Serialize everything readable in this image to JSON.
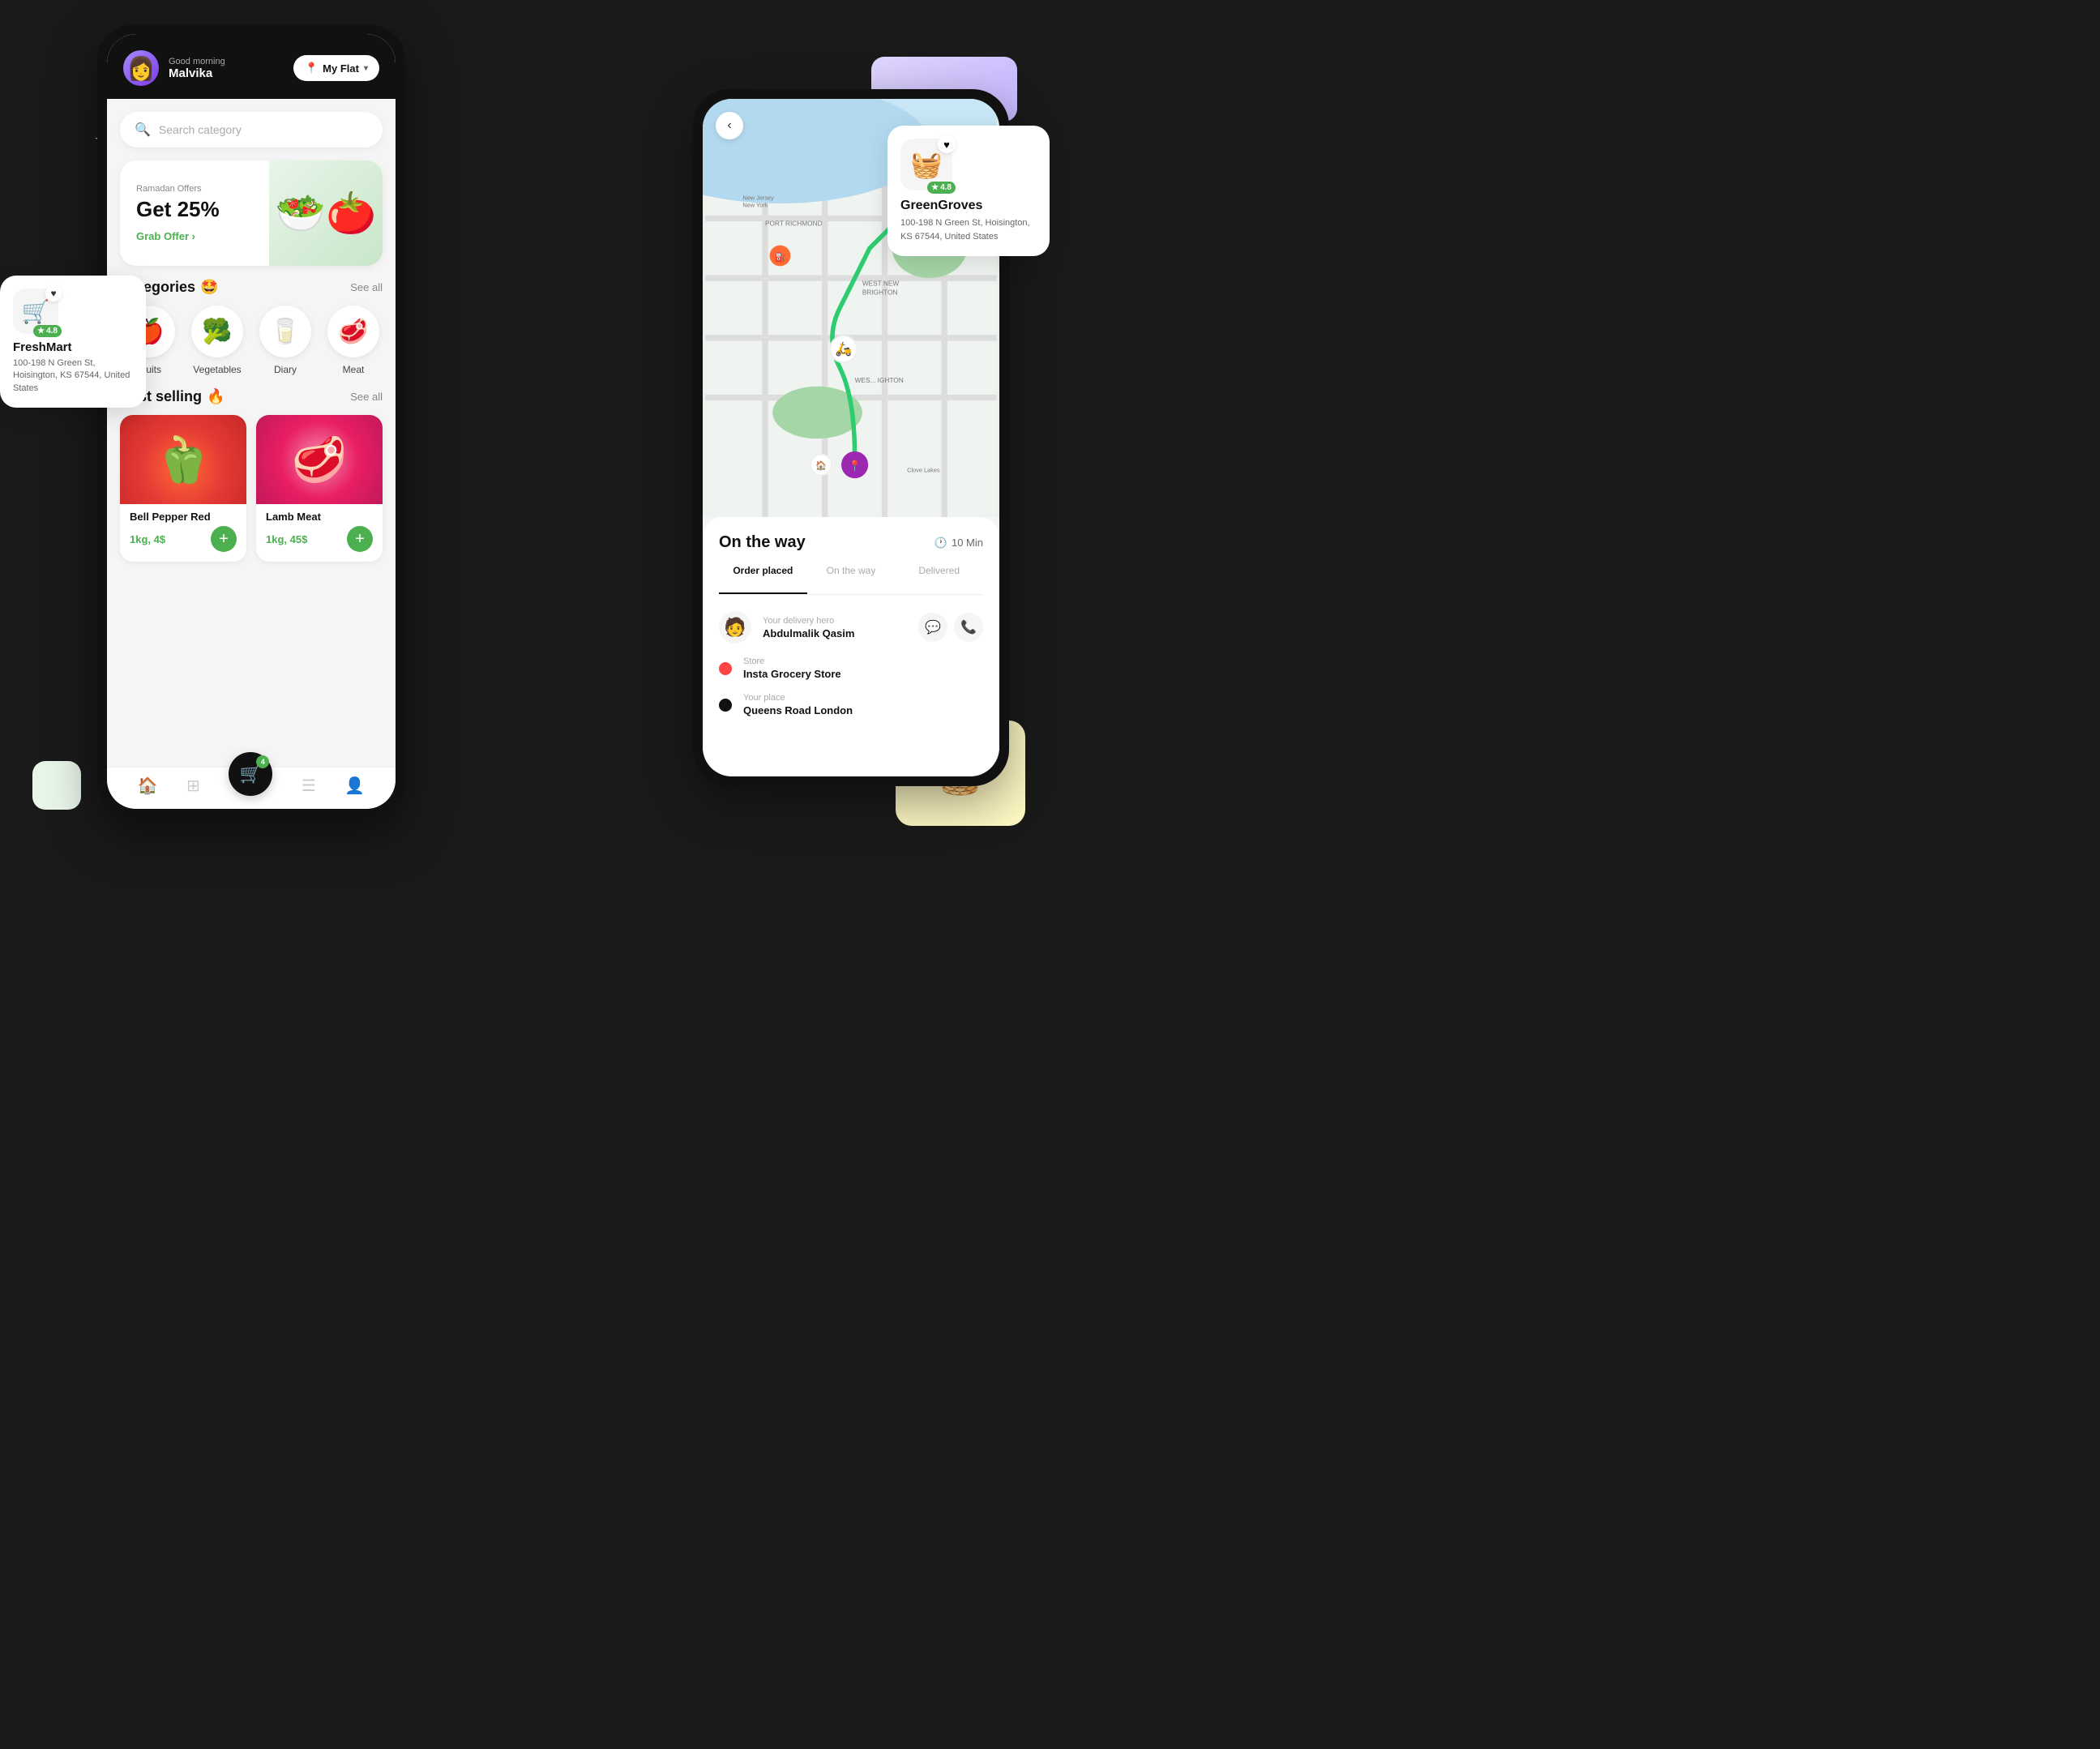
{
  "header": {
    "greeting": "Good morning",
    "user_name": "Malvika",
    "location": "My Flat",
    "location_icon": "📍"
  },
  "search": {
    "placeholder": "Search category"
  },
  "banner": {
    "tag": "Ramadan Offers",
    "title": "Get 25%",
    "button_label": "Grab Offer ›",
    "emoji": "🥗"
  },
  "categories": {
    "title": "Categories",
    "emoji": "🤩",
    "see_all": "See all",
    "items": [
      {
        "label": "Fruits",
        "emoji": "🍎"
      },
      {
        "label": "Vegetables",
        "emoji": "🥦"
      },
      {
        "label": "Diary",
        "emoji": "🥛"
      },
      {
        "label": "Meat",
        "emoji": "🥩"
      }
    ]
  },
  "best_selling": {
    "title": "Best selling",
    "emoji": "🔥",
    "see_all": "See all",
    "products": [
      {
        "name": "Bell Pepper Red",
        "price": "1kg, 4$",
        "emoji": "🫑"
      },
      {
        "name": "Lamb Meat",
        "price": "1kg, 45$",
        "emoji": "🥩"
      }
    ]
  },
  "bottom_nav": {
    "items": [
      "🏠",
      "⊞",
      "🛒",
      "☰",
      "👤"
    ],
    "cart_count": "4"
  },
  "delivery": {
    "title": "On the way",
    "time": "10 Min",
    "steps": [
      "Order placed",
      "On the way",
      "Delivered"
    ],
    "active_step": 0,
    "hero": {
      "label": "Your delivery hero",
      "name": "Abdulmalik Qasim",
      "emoji": "🧑"
    },
    "store": {
      "label": "Store",
      "name": "Insta Grocery Store"
    },
    "destination": {
      "label": "Your place",
      "name": "Queens Road London"
    }
  },
  "freshmart": {
    "name": "FreshMart",
    "address": "100-198 N Green St, Hoisington, KS 67544, United States",
    "emoji": "🛒",
    "rating": "4.8"
  },
  "greengroves": {
    "name": "GreenGroves",
    "address": "100-198 N Green St, Hoisington, KS 67544, United States",
    "emoji": "🧺",
    "rating": "4.8"
  },
  "decorative": {
    "star_white": "✦",
    "star_yellow": "★"
  }
}
